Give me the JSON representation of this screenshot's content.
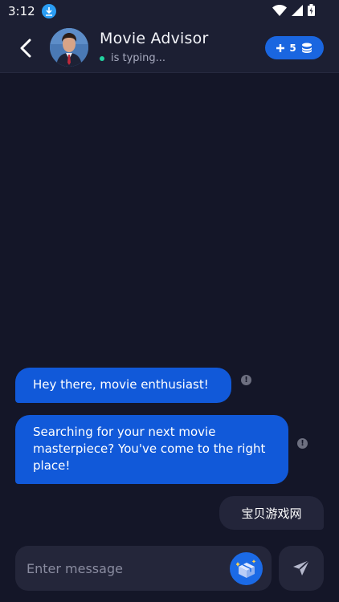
{
  "status": {
    "time": "3:12"
  },
  "header": {
    "title": "Movie Advisor",
    "typing": "is typing...",
    "credits": "5"
  },
  "messages": [
    {
      "from": "bot",
      "text": "Hey there, movie enthusiast!"
    },
    {
      "from": "bot",
      "text": "Searching for your next movie masterpiece? You've come to the right place!"
    },
    {
      "from": "user",
      "text": "宝贝游戏网"
    }
  ],
  "composer": {
    "placeholder": "Enter message"
  },
  "colors": {
    "accent": "#1159d9",
    "background": "#141628",
    "online": "#22d3a0"
  }
}
